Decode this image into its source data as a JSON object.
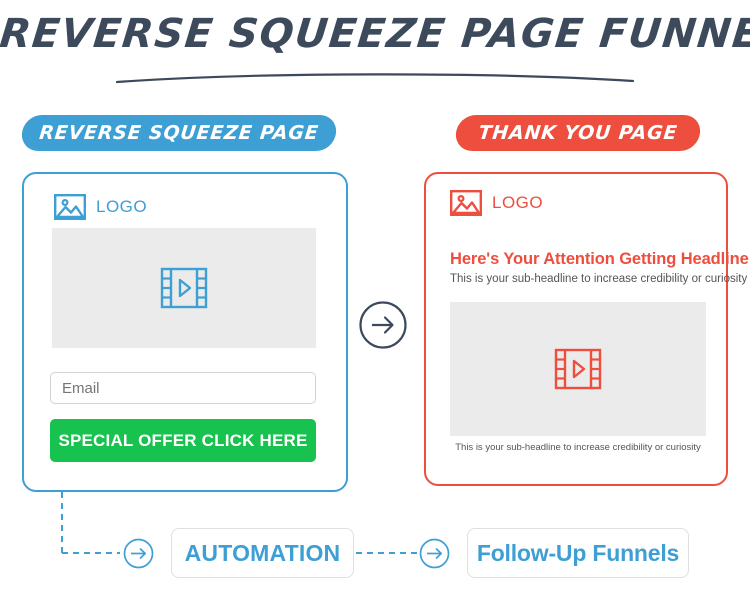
{
  "title": {
    "text": "REVERSE SQUEEZE PAGE FUNNEL"
  },
  "colors": {
    "blue": "#3e9fd4",
    "red": "#ee4e3d",
    "green": "#17c24e",
    "slate": "#3c4a5c",
    "gray_placeholder": "#ebebeb",
    "text_gray": "#555555"
  },
  "badges": {
    "reverse_squeeze": "REVERSE SQUEEZE PAGE",
    "thank_you": "THANK YOU PAGE"
  },
  "reverse_page": {
    "logo_label": "LOGO",
    "logo_icon": "image-placeholder-icon",
    "video_icon": "film-play-icon",
    "email_placeholder": "Email",
    "email_value": "",
    "cta_label": "SPECIAL OFFER CLICK HERE"
  },
  "thank_you_page": {
    "logo_label": "LOGO",
    "logo_icon": "image-placeholder-icon",
    "headline": "Here's Your Attention Getting Headline",
    "subheadline": "This is your sub-headline to increase credibility or curiosity",
    "video_icon": "film-play-icon",
    "caption": "This is your sub-headline to increase credibility or curiosity"
  },
  "center_arrow": {
    "icon": "arrow-right-circle-icon"
  },
  "flow": {
    "arrow_1_icon": "arrow-right-circle-icon",
    "automation_label": "AUTOMATION",
    "arrow_2_icon": "arrow-right-circle-icon",
    "followup_label": "Follow-Up Funnels"
  }
}
